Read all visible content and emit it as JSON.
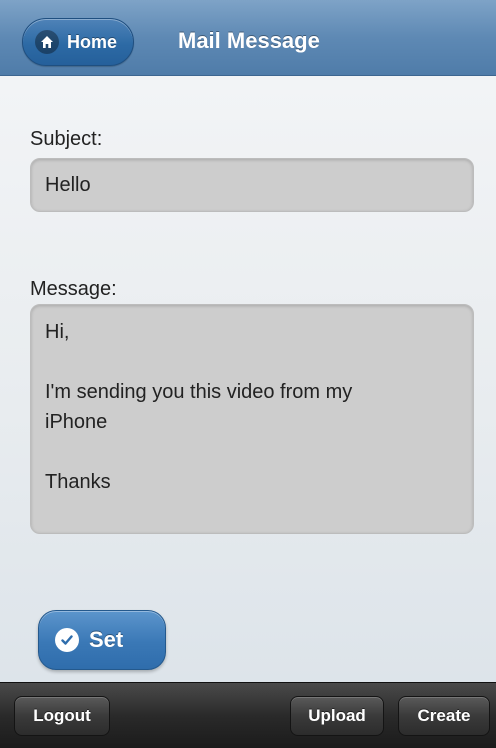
{
  "header": {
    "home_label": "Home",
    "title": "Mail Message"
  },
  "form": {
    "subject_label": "Subject:",
    "subject_value": "Hello",
    "message_label": "Message:",
    "message_lines": [
      "Hi,",
      "",
      "I'm sending you this video from my",
      "iPhone",
      "",
      "Thanks"
    ],
    "set_label": "Set"
  },
  "toolbar": {
    "logout_label": "Logout",
    "upload_label": "Upload",
    "create_label": "Create"
  },
  "icons": {
    "home": "home-icon",
    "check": "checkmark-icon"
  },
  "colors": {
    "header": "#5e89b4",
    "button_blue": "#3a78b6",
    "field_bg": "#cdcdcd",
    "toolbar": "#2a2a2a"
  }
}
